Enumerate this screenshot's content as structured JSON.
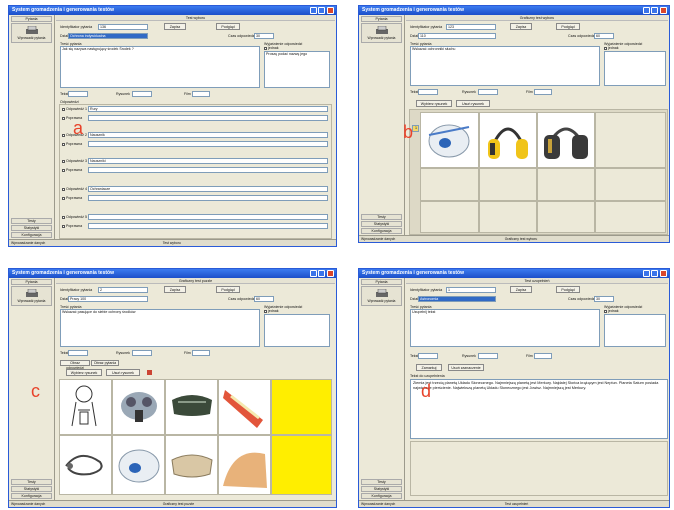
{
  "app_title": "System gromadzenia i generowania testów",
  "labels": {
    "a": "a",
    "b": "b",
    "c": "c",
    "d": "d"
  },
  "left_panel": {
    "pytania": "Pytania",
    "wprowadz": "Wprowadź pytania",
    "testy": "Testy",
    "statystyki": "Statystyki",
    "konfiguracja": "Konfiguracja"
  },
  "common": {
    "identyfikator": "Identyfikator pytania",
    "dzial": "Dział",
    "czas": "Czas odpowiedzi [s]",
    "zapisz": "Zapisz",
    "podglad": "Podgląd",
    "tresc": "Treść pytania",
    "wyjasnienie": "Wyjaśnienie odpowiedzi",
    "jednak": "jednak",
    "tekst": "Tekst",
    "rysunek": "Rysunek",
    "film": "Film",
    "status_left": "Wprowadzanie danych"
  },
  "a": {
    "header": "Test wyboru",
    "id": "136",
    "dzial": "Ochrona indywidualna",
    "czas": "30",
    "question": "Jak się nazywa następujący środek Środek ?",
    "explanation": "Proszę podać nazwę jego",
    "odpowiedzi": "Odpowiedzi",
    "answers": [
      {
        "label": "Odpowiedź 1",
        "value": "Rury",
        "checked": true
      },
      {
        "label": "Poprawna",
        "value": "",
        "checked": false
      },
      {
        "label": "Odpowiedź 2",
        "value": "Nausznik",
        "checked": true
      },
      {
        "label": "Poprawna",
        "value": "",
        "checked": false
      },
      {
        "label": "Odpowiedź 3",
        "value": "Nauszniki",
        "checked": true
      },
      {
        "label": "Poprawna",
        "value": "",
        "checked": false
      },
      {
        "label": "Odpowiedź 4",
        "value": "Ochraniacze",
        "checked": true
      },
      {
        "label": "Poprawna",
        "value": "",
        "checked": false
      },
      {
        "label": "Odpowiedź 5",
        "value": "",
        "checked": false
      },
      {
        "label": "Poprawna",
        "value": "",
        "checked": false
      }
    ],
    "status_mid": "Test wyboru"
  },
  "b": {
    "header": "Graficzny test wyboru",
    "id": "123",
    "dzial": "110",
    "czas": "60",
    "question": "Wskazać ochronniki słuchu",
    "wybierz": "Wybierz rysunek",
    "usun": "Usuń rysunek",
    "row_marker": "1",
    "status_mid": "Graficzny test wyboru"
  },
  "c": {
    "header": "Graficzny test puzzle",
    "id": "2",
    "dzial": "Pracy 100",
    "czas": "60",
    "question": "Wskazać pasujące do siebie ochrony środków",
    "tab1": "Obraz odpowiedzi",
    "tab2": "Obraz pytania",
    "wybierz": "Wybierz rysunek",
    "usun": "Usuń rysunek",
    "status_mid": "Graficzny test puzzle"
  },
  "d": {
    "header": "Test uzupełnień",
    "id": "1",
    "dzial": "Astronomia",
    "czas": "30",
    "question": "Uzupełnij tekst",
    "zamarkuj": "Zamarkuj",
    "usun_zaznaczenie": "Usuń zaznaczenie",
    "text_header": "Tekst do uzupełnienia",
    "paragraph": "Ziemia jest trzecią planetą Układu Słonecznego. Najmniejszą planetą jest Merkury. Najdalej Słońca krążącym jest Neptun. Planeta Saturn posiada największe pierścienie. Najwiekszą planetą Układu Słonecznego jest Jowisz. Najmniejszą jest Merkury.",
    "status_mid": "Test uzupełnień"
  },
  "colors": {
    "title_bar": "#1c4fc9",
    "window_bg": "#ece9d8",
    "yellow": "#ffee00",
    "letter": "#e8432a",
    "close": "#d9472b"
  }
}
